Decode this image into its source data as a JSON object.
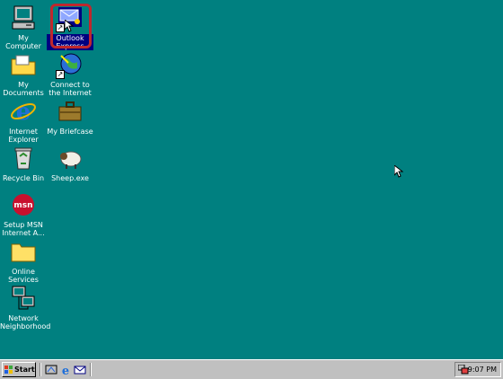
{
  "desktop": {
    "background_color": "#008080",
    "icons": [
      {
        "label": "My Computer",
        "icon": "computer-icon"
      },
      {
        "label": "Outlook Express",
        "icon": "outlook-express-icon"
      },
      {
        "label": "My Documents",
        "icon": "folder-documents-icon"
      },
      {
        "label": "Connect to the Internet",
        "icon": "connect-internet-icon"
      },
      {
        "label": "Internet Explorer",
        "icon": "internet-explorer-icon"
      },
      {
        "label": "My Briefcase",
        "icon": "briefcase-icon"
      },
      {
        "label": "Recycle Bin",
        "icon": "recycle-bin-icon"
      },
      {
        "label": "Sheep.exe",
        "icon": "sheep-icon"
      },
      {
        "label": "Setup MSN Internet A...",
        "icon": "msn-icon"
      },
      {
        "label": "Online Services",
        "icon": "folder-icon"
      },
      {
        "label": "Network Neighborhood",
        "icon": "network-icon"
      }
    ],
    "selected_icon": "Outlook Express"
  },
  "taskbar": {
    "start_label": "Start",
    "quick_launch": [
      "show-desktop-icon",
      "internet-explorer-icon",
      "outlook-express-icon"
    ],
    "clock": "9:07 PM"
  },
  "colors": {
    "desktop": "#008080",
    "taskbar": "#c0c0c0",
    "selection": "#000080",
    "highlight_ring": "#c0272d"
  }
}
